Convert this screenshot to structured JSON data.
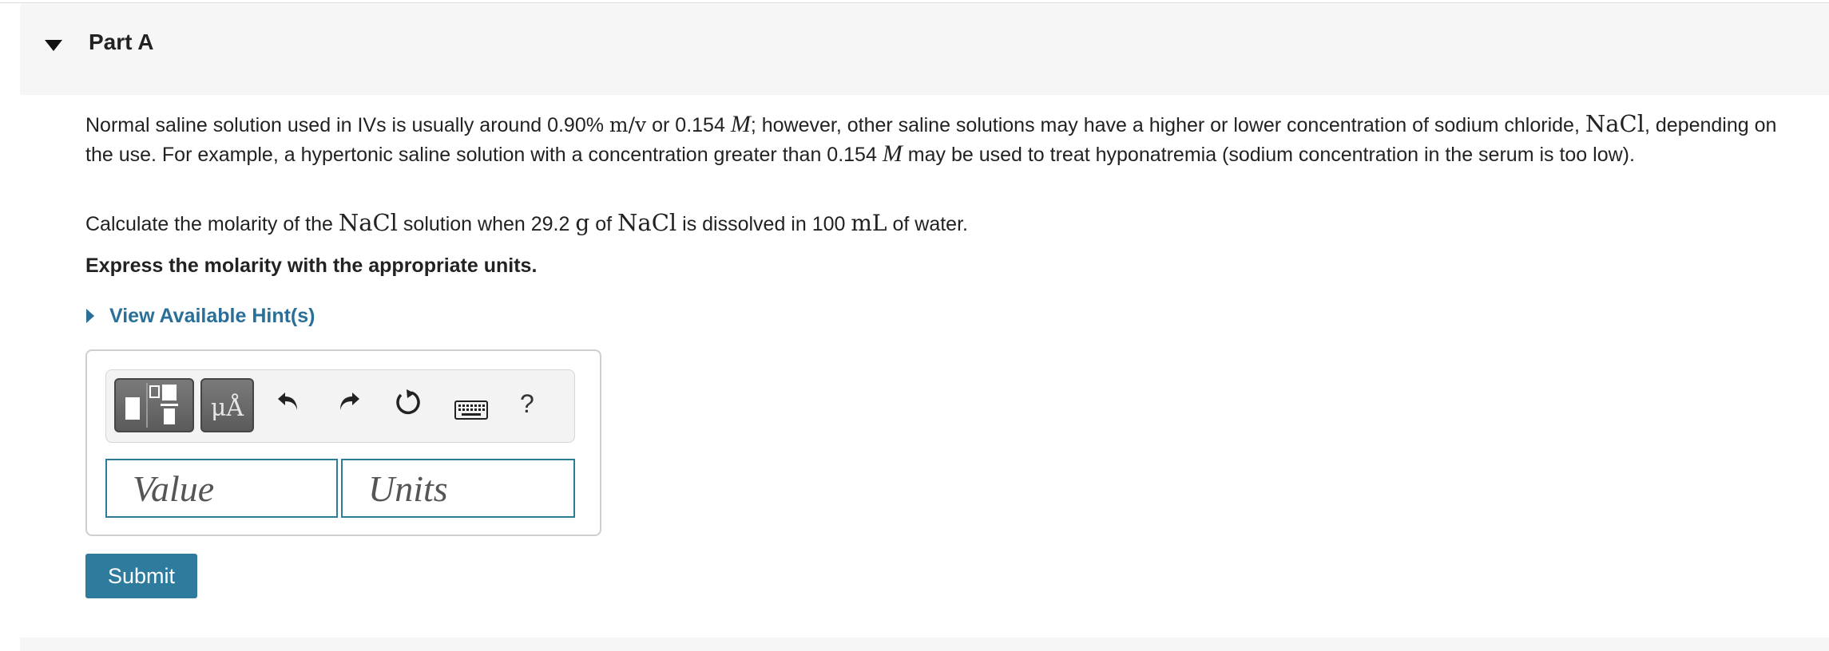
{
  "part": {
    "title": "Part A"
  },
  "question": {
    "p1_a": "Normal saline solution used in IVs is usually around 0.90% ",
    "p1_mv": "m/v",
    "p1_b": " or 0.154 ",
    "p1_M": "M",
    "p1_c": "; however, other saline solutions may have a higher or lower concentration of sodium chloride, ",
    "p1_nacl": "NaCl",
    "p1_d": ", depending on the use. For example, a hypertonic saline solution with a concentration greater than 0.154 ",
    "p1_M2": "M",
    "p1_e": " may be used to treat hyponatremia (sodium concentration in the serum is too low).",
    "p2_a": "Calculate the molarity of the ",
    "p2_nacl": "NaCl",
    "p2_b": " solution when 29.2 ",
    "p2_g": "g",
    "p2_c": " of ",
    "p2_nacl2": "NaCl",
    "p2_d": " is dissolved in 100 ",
    "p2_ml": "mL",
    "p2_e": " of water.",
    "instruction": "Express the molarity with the appropriate units."
  },
  "hints": {
    "label": "View Available Hint(s)"
  },
  "toolbar": {
    "templates_icon": "templates-icon",
    "units_label": "μÅ",
    "undo_icon": "undo-icon",
    "redo_icon": "redo-icon",
    "reset_icon": "reset-icon",
    "keyboard_icon": "keyboard-icon",
    "help_label": "?"
  },
  "inputs": {
    "value_placeholder": "Value",
    "units_placeholder": "Units"
  },
  "submit": {
    "label": "Submit"
  },
  "colors": {
    "accent": "#2f7b9d",
    "link": "#2a6f97",
    "field_border": "#2d7a9a"
  }
}
